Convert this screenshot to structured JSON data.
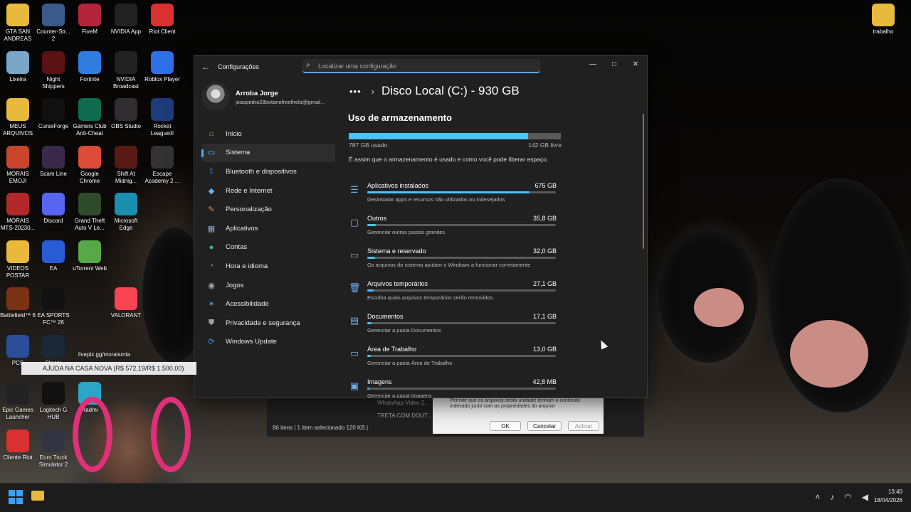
{
  "desktop": {
    "icons": [
      {
        "label": "GTA SAN ANDREAS",
        "icon": "folder-icon",
        "color": "#e8b93a"
      },
      {
        "label": "Counter-Str... 2",
        "icon": "counter-strike-icon",
        "color": "#3b5a8c"
      },
      {
        "label": "FiveM",
        "icon": "fivem-icon",
        "color": "#b4243b"
      },
      {
        "label": "NVIDIA App",
        "icon": "nvidia-icon",
        "color": "#222"
      },
      {
        "label": "Riot Client",
        "icon": "riot-icon",
        "color": "#d93030"
      },
      {
        "label": "Lixeira",
        "icon": "recycle-bin-icon",
        "color": "#7aa6c8"
      },
      {
        "label": "Night Shippers",
        "icon": "night-shippers-icon",
        "color": "#5a1212"
      },
      {
        "label": "Fortnite",
        "icon": "fortnite-icon",
        "color": "#2f7de0"
      },
      {
        "label": "NVIDIA Broadcast",
        "icon": "nvidia-broadcast-icon",
        "color": "#222"
      },
      {
        "label": "Roblox Player",
        "icon": "roblox-icon",
        "color": "#2f6fe8"
      },
      {
        "label": "MEUS ARQUIVOS",
        "icon": "folder-icon",
        "color": "#e8b93a"
      },
      {
        "label": "CurseForge",
        "icon": "curseforge-icon",
        "color": "#111"
      },
      {
        "label": "Gamers Club Anti-Cheat",
        "icon": "gamers-club-icon",
        "color": "#0f6b4d"
      },
      {
        "label": "OBS Studio",
        "icon": "obs-icon",
        "color": "#302e31"
      },
      {
        "label": "Rocket League®",
        "icon": "rocket-league-icon",
        "color": "#1c3d7a"
      },
      {
        "label": "MORAIS EMOJI",
        "icon": "folder-icon",
        "color": "#c9452c"
      },
      {
        "label": "Scam Line",
        "icon": "scam-line-icon",
        "color": "#3a2a4a"
      },
      {
        "label": "Google Chrome",
        "icon": "chrome-icon",
        "color": "#dd4b39"
      },
      {
        "label": "Shift At Midnig...",
        "icon": "shift-at-midnight-icon",
        "color": "#5a1a14"
      },
      {
        "label": "Escape Academy 2 ...",
        "icon": "escape-academy-icon",
        "color": "#333"
      },
      {
        "label": "MORAIS MTS-20230...",
        "icon": "folder-icon",
        "color": "#b02828"
      },
      {
        "label": "Discord",
        "icon": "discord-icon",
        "color": "#5865f2"
      },
      {
        "label": "Grand Theft Auto V Le...",
        "icon": "gta-v-icon",
        "color": "#2e4a2a"
      },
      {
        "label": "Microsoft Edge",
        "icon": "edge-icon",
        "color": "#1a8fb0"
      },
      {
        "label": "VIDEOS POSTAR",
        "icon": "folder-icon",
        "color": "#e8b93a"
      },
      {
        "label": "EA",
        "icon": "ea-icon",
        "color": "#2a5bd7"
      },
      {
        "label": "uTorrent Web",
        "icon": "utorrent-icon",
        "color": "#57a846"
      },
      {
        "label": "Battlefield™ 6",
        "icon": "battlefield-icon",
        "color": "#7a3214"
      },
      {
        "label": "EA SPORTS FC™ 26",
        "icon": "ea-fc-icon",
        "color": "#111"
      },
      {
        "label": "VALORANT",
        "icon": "valorant-icon",
        "color": "#fa4454"
      },
      {
        "label": "PCS",
        "icon": "pcs-icon",
        "color": "#2a4e9a"
      },
      {
        "label": "Steam",
        "icon": "steam-icon",
        "color": "#1b2838"
      },
      {
        "label": "Epic Games Launcher",
        "icon": "epic-games-icon",
        "color": "#222"
      },
      {
        "label": "Logitech G HUB",
        "icon": "logitech-icon",
        "color": "#111"
      },
      {
        "label": "Radmi",
        "icon": "radmin-icon",
        "color": "#2aa6c9"
      },
      {
        "label": "Cliente Riot",
        "icon": "riot-icon",
        "color": "#d93030"
      },
      {
        "label": "Euro Truck Simulator 2",
        "icon": "euro-truck-icon",
        "color": "#334"
      },
      {
        "label": "trabalho",
        "icon": "folder-icon",
        "color": "#e8b93a"
      }
    ]
  },
  "overlay": {
    "pix_text": "livepix.gg/moraismta",
    "donation_banner": "AJUDA NA CASA NOVA (R$ 572,19/R$ 1.500,00)"
  },
  "explorer": {
    "rows": [
      "WhatsApp Video 2...",
      "TRETA COM DOUT..."
    ],
    "status": "86 itens  |  1 item selecionado  120 KB  |"
  },
  "props_dialog": {
    "text": "Permitir que os arquivos desta unidade tenham o conteúdo indexado junto com as propriedades do arquivo",
    "ok": "OK",
    "cancel": "Cancelar",
    "apply": "Aplicar"
  },
  "settings": {
    "app_title": "Configurações",
    "search_placeholder": "Localizar uma configuração",
    "profile": {
      "name": "Arroba Jorge",
      "email": "joaopedro28botanofreefirela@gmail..."
    },
    "nav": [
      {
        "label": "Início",
        "icon": "home-icon",
        "glyph": "⌂",
        "color": "#f0a35a"
      },
      {
        "label": "Sistema",
        "icon": "system-icon",
        "glyph": "▭",
        "color": "#4cc2ff",
        "active": true
      },
      {
        "label": "Bluetooth e dispositivos",
        "icon": "bluetooth-icon",
        "glyph": "ᛒ",
        "color": "#3a8ee6"
      },
      {
        "label": "Rede e Internet",
        "icon": "network-icon",
        "glyph": "◆",
        "color": "#6ab8f0"
      },
      {
        "label": "Personalização",
        "icon": "personalization-icon",
        "glyph": "✎",
        "color": "#f08a3a"
      },
      {
        "label": "Aplicativos",
        "icon": "apps-icon",
        "glyph": "▦",
        "color": "#8aa9c8"
      },
      {
        "label": "Contas",
        "icon": "accounts-icon",
        "glyph": "●",
        "color": "#3ac28a"
      },
      {
        "label": "Hora e idioma",
        "icon": "time-language-icon",
        "glyph": "◔",
        "color": "#4ca0e0"
      },
      {
        "label": "Jogos",
        "icon": "gaming-icon",
        "glyph": "◉",
        "color": "#aaaaaa"
      },
      {
        "label": "Acessibilidade",
        "icon": "accessibility-icon",
        "glyph": "✶",
        "color": "#4aa3ea"
      },
      {
        "label": "Privacidade e segurança",
        "icon": "privacy-shield-icon",
        "glyph": "⛊",
        "color": "#9aa0a8"
      },
      {
        "label": "Windows Update",
        "icon": "windows-update-icon",
        "glyph": "⟳",
        "color": "#3a8ee6"
      }
    ],
    "breadcrumb_dots": "•••",
    "breadcrumb_sep": "›",
    "page_title": "Disco Local (C:) - 930 GB",
    "section_title": "Uso de armazenamento",
    "used_label": "787 GB usado",
    "free_label": "142 GB livre",
    "used_fraction": 0.846,
    "description": "É assim que o armazenamento é usado e como você pode liberar espaço.",
    "categories": [
      {
        "name": "Aplicativos instalados",
        "size": "675 GB",
        "desc": "Desinstalar apps e recursos não utilizados ou indesejados",
        "icon": "apps-list-icon",
        "glyph": "☰",
        "fraction": 0.86
      },
      {
        "name": "Outros",
        "size": "35,8 GB",
        "desc": "Gerenciar outras pastas grandes",
        "icon": "other-files-icon",
        "glyph": "▢",
        "fraction": 0.045
      },
      {
        "name": "Sistema e reservado",
        "size": "32,0 GB",
        "desc": "Os arquivos do sistema ajudam o Windows a funcionar corretamente",
        "icon": "system-reserved-icon",
        "glyph": "▭",
        "fraction": 0.04
      },
      {
        "name": "Arquivos temporários",
        "size": "27,1 GB",
        "desc": "Escolha quais arquivos temporários serão removidos",
        "icon": "trash-icon",
        "glyph": "🗑",
        "fraction": 0.035
      },
      {
        "name": "Documentos",
        "size": "17,1 GB",
        "desc": "Gerenciar a pasta Documentos",
        "icon": "documents-folder-icon",
        "glyph": "▤",
        "fraction": 0.022
      },
      {
        "name": "Área de Trabalho",
        "size": "13,0 GB",
        "desc": "Gerenciar a pasta Área de Trabalho",
        "icon": "desktop-icon",
        "glyph": "▭",
        "fraction": 0.017
      },
      {
        "name": "Imagens",
        "size": "42,8 MB",
        "desc": "Gerenciar a pasta Imagens",
        "icon": "images-icon",
        "glyph": "▣",
        "fraction": 0.002
      }
    ]
  },
  "taskbar": {
    "time": "13:40",
    "date": "18/04/2026"
  }
}
